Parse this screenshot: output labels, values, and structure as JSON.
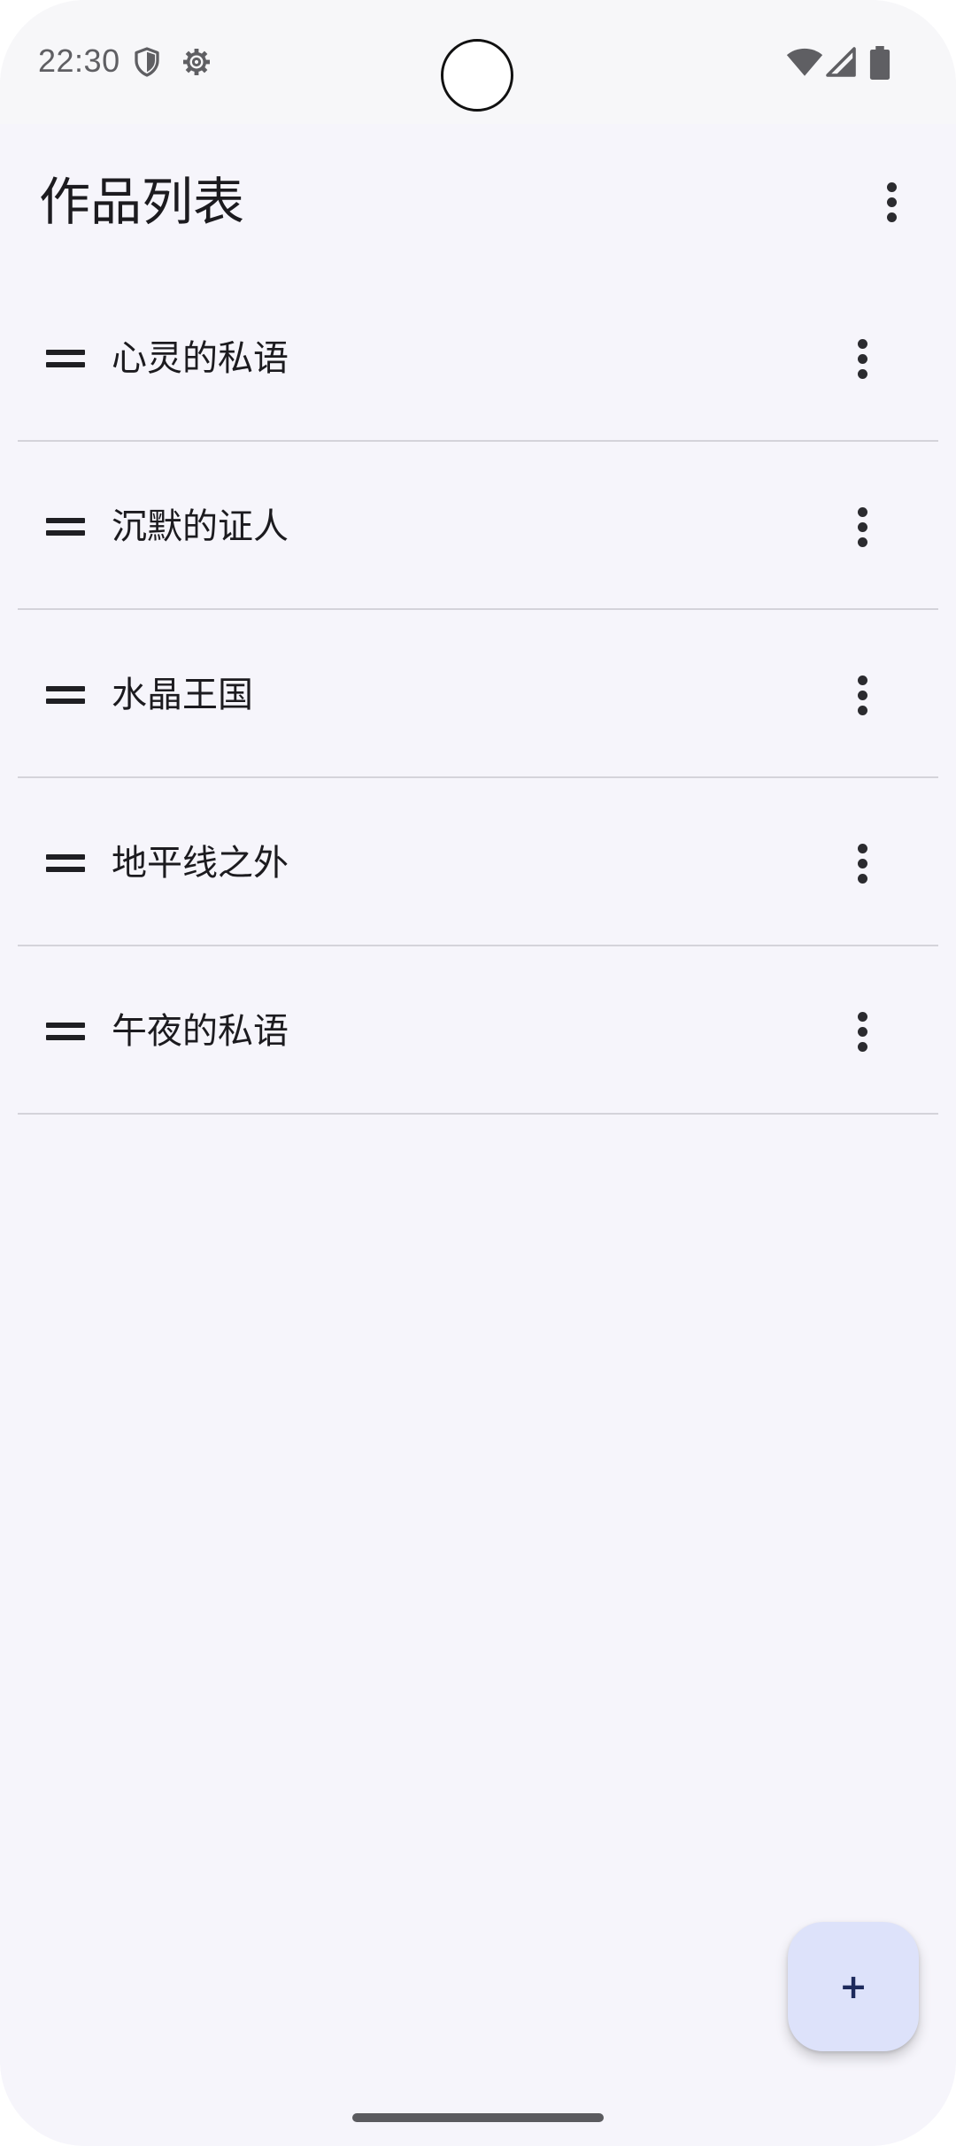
{
  "status_bar": {
    "time": "22:30",
    "icons": [
      "shield-icon",
      "gear-icon",
      "wifi-icon",
      "signal-icon",
      "battery-icon"
    ],
    "icon_color": "#5f5f63"
  },
  "app_bar": {
    "title": "作品列表",
    "menu_icon": "more-vert-icon"
  },
  "works": [
    {
      "title": "心灵的私语"
    },
    {
      "title": "沉默的证人"
    },
    {
      "title": "水晶王国"
    },
    {
      "title": "地平线之外"
    },
    {
      "title": "午夜的私语"
    }
  ],
  "row_icons": {
    "leading": "drag-handle-icon",
    "trailing": "more-vert-icon"
  },
  "fab": {
    "label": "+",
    "background": "#dde2fa",
    "foreground": "#1d2a5c"
  },
  "colors": {
    "background": "#f6f5fb",
    "divider": "#d4d3da",
    "text": "#1c1b1f"
  }
}
